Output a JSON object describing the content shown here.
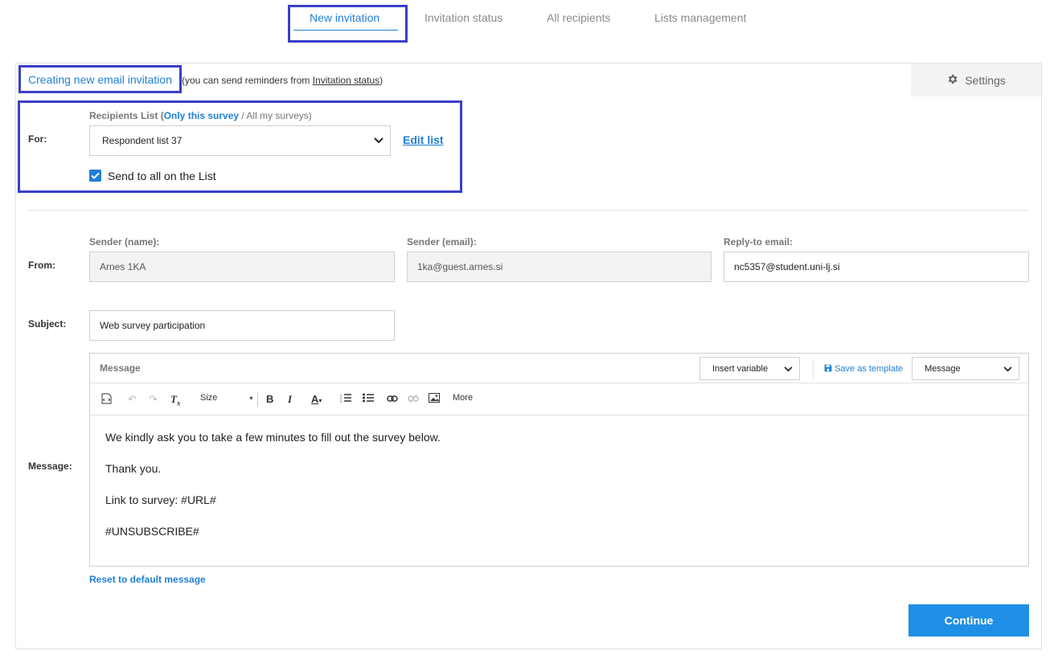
{
  "tabs": [
    {
      "label": "New invitation",
      "active": true
    },
    {
      "label": "Invitation status",
      "active": false
    },
    {
      "label": "All recipients",
      "active": false
    },
    {
      "label": "Lists management",
      "active": false
    }
  ],
  "settings": {
    "label": "Settings",
    "icon": "gear-icon"
  },
  "header": {
    "title": "Creating new email invitation",
    "subtitle_prefix": "(you can send reminders from ",
    "subtitle_link": "Invitation status",
    "subtitle_suffix": ")"
  },
  "for_section": {
    "label": "For:",
    "recipients_prefix": "Recipients List (",
    "only_this_survey": "Only this survey",
    "separator": " / ",
    "all_my_surveys": "All my surveys",
    "recipients_suffix": ")",
    "selected_list": "Respondent list 37",
    "edit_list": "Edit list",
    "send_to_all_label": "Send to all on the List",
    "send_to_all_checked": true
  },
  "from_section": {
    "label": "From:",
    "sender_name_label": "Sender (name):",
    "sender_name_value": "Arnes 1KA",
    "sender_email_label": "Sender (email):",
    "sender_email_value": "1ka@guest.arnes.si",
    "reply_to_label": "Reply-to email:",
    "reply_to_value": "nc5357@student.uni-lj.si"
  },
  "subject_section": {
    "label": "Subject:",
    "value": "Web survey participation"
  },
  "message_section": {
    "label": "Message:",
    "editor_label": "Message",
    "insert_variable": "Insert variable",
    "save_as_template": "Save as template",
    "template_select": "Message",
    "toolbar": {
      "size": "Size",
      "more": "More"
    },
    "lines": [
      "We kindly ask you to take a few minutes to fill out the survey below.",
      "Thank you.",
      "Link to survey: #URL#",
      "#UNSUBSCRIBE#"
    ],
    "reset_link": "Reset to default message"
  },
  "continue_button": "Continue",
  "colors": {
    "accent": "#1f7fd6",
    "highlight": "#3b3fc8",
    "button": "#1f8fe6"
  }
}
